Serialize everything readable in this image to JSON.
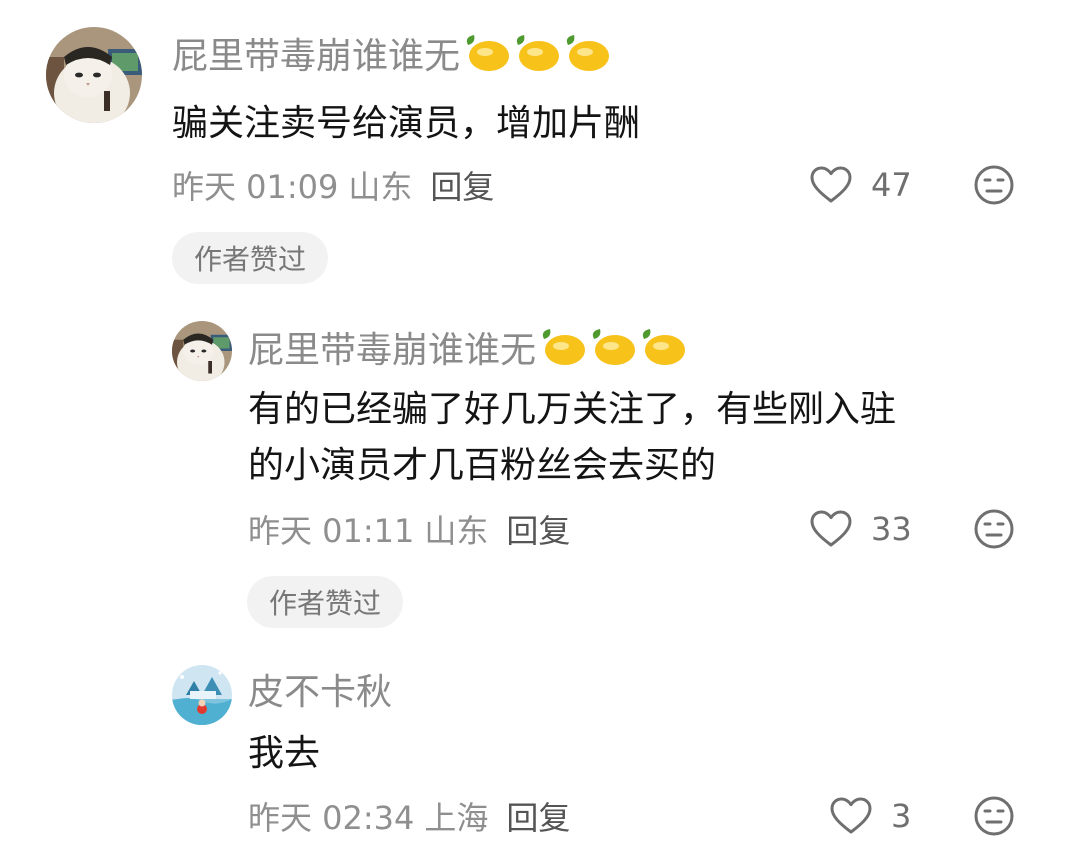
{
  "comments": [
    {
      "username": "屁里带毒崩谁谁无",
      "badges": [
        "lemon-icon",
        "lemon-icon",
        "lemon-icon"
      ],
      "text": "骗关注卖号给演员，增加片酬",
      "date": "昨天 01:09",
      "location": "山东",
      "reply_label": "回复",
      "likes": "47",
      "author_liked_label": "作者赞过"
    },
    {
      "username": "屁里带毒崩谁谁无",
      "badges": [
        "lemon-icon",
        "lemon-icon",
        "lemon-icon"
      ],
      "text_line1": "有的已经骗了好几万关注了，有些刚入驻",
      "text_line2": "的小演员才几百粉丝会去买的",
      "date": "昨天 01:11",
      "location": "山东",
      "reply_label": "回复",
      "likes": "33",
      "author_liked_label": "作者赞过"
    },
    {
      "username": "皮不卡秋",
      "text": "我去",
      "date": "昨天 02:34",
      "location": "上海",
      "reply_label": "回复",
      "likes": "3"
    }
  ],
  "colors": {
    "username": "#8a8a8a",
    "text": "#141414",
    "meta": "#8f8f8f",
    "reply": "#555555",
    "badge_bg": "#f2f2f2",
    "lemon": "#f7c21a"
  }
}
